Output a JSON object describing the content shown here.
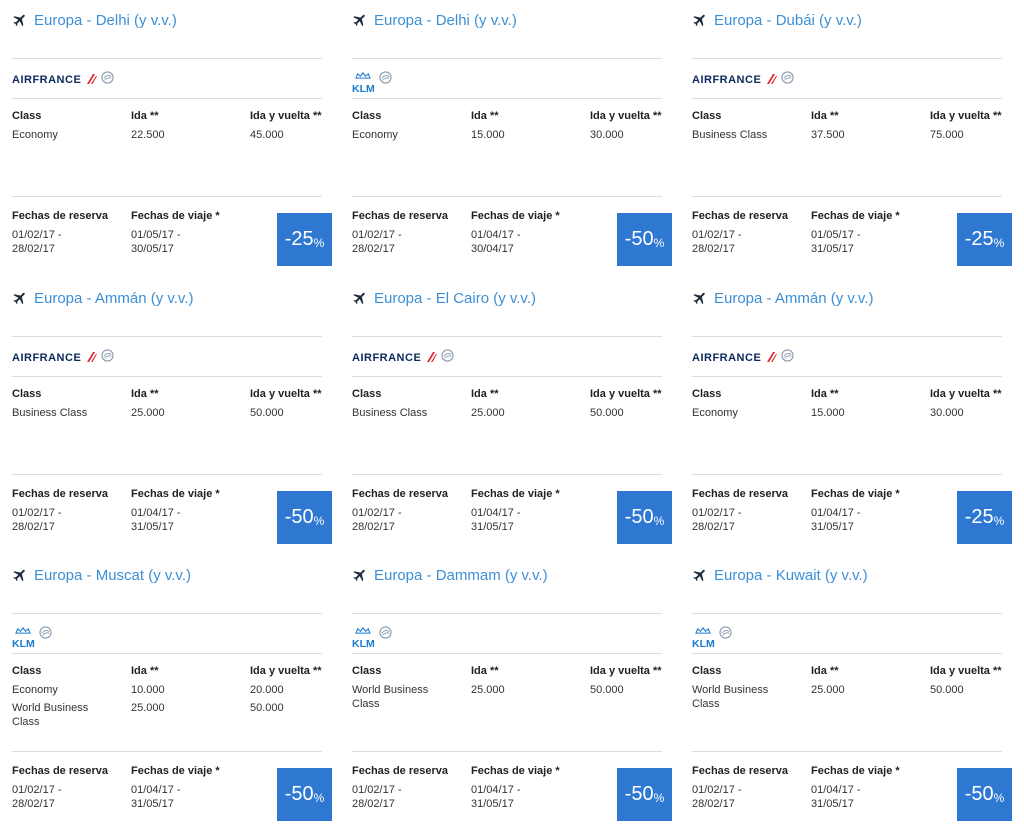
{
  "labels": {
    "class": "Class",
    "ida": "Ida **",
    "ida_vuelta": "Ida y vuelta **",
    "fechas_reserva": "Fechas de reserva",
    "fechas_viaje": "Fechas de viaje *",
    "percent": "%"
  },
  "colors": {
    "title": "#3d8fd6",
    "discount_bg": "#2e78d2",
    "airfrance_navy": "#0b2a5b",
    "airfrance_red": "#e1222a",
    "klm_blue": "#1a7bd1"
  },
  "cards": [
    {
      "title": "Europa - Delhi (y v.v.)",
      "airline": "AIRFRANCE",
      "rows": [
        {
          "class": "Economy",
          "ida": "22.500",
          "ida_vuelta": "45.000"
        }
      ],
      "reserva": [
        "01/02/17 -",
        "28/02/17"
      ],
      "viaje": [
        "01/05/17 -",
        "30/05/17"
      ],
      "discount": "-25"
    },
    {
      "title": "Europa - Delhi (y v.v.)",
      "airline": "KLM",
      "rows": [
        {
          "class": "Economy",
          "ida": "15.000",
          "ida_vuelta": "30.000"
        }
      ],
      "reserva": [
        "01/02/17 -",
        "28/02/17"
      ],
      "viaje": [
        "01/04/17 -",
        "30/04/17"
      ],
      "discount": "-50"
    },
    {
      "title": "Europa - Dubái (y v.v.)",
      "airline": "AIRFRANCE",
      "rows": [
        {
          "class": "Business Class",
          "ida": "37.500",
          "ida_vuelta": "75.000"
        }
      ],
      "reserva": [
        "01/02/17 -",
        "28/02/17"
      ],
      "viaje": [
        "01/05/17 -",
        "31/05/17"
      ],
      "discount": "-25"
    },
    {
      "title": "Europa - Ammán (y v.v.)",
      "airline": "AIRFRANCE",
      "rows": [
        {
          "class": "Business Class",
          "ida": "25.000",
          "ida_vuelta": "50.000"
        }
      ],
      "reserva": [
        "01/02/17 -",
        "28/02/17"
      ],
      "viaje": [
        "01/04/17 -",
        "31/05/17"
      ],
      "discount": "-50"
    },
    {
      "title": "Europa - El Cairo (y v.v.)",
      "airline": "AIRFRANCE",
      "rows": [
        {
          "class": "Business Class",
          "ida": "25.000",
          "ida_vuelta": "50.000"
        }
      ],
      "reserva": [
        "01/02/17 -",
        "28/02/17"
      ],
      "viaje": [
        "01/04/17 -",
        "31/05/17"
      ],
      "discount": "-50"
    },
    {
      "title": "Europa - Ammán (y v.v.)",
      "airline": "AIRFRANCE",
      "rows": [
        {
          "class": "Economy",
          "ida": "15.000",
          "ida_vuelta": "30.000"
        }
      ],
      "reserva": [
        "01/02/17 -",
        "28/02/17"
      ],
      "viaje": [
        "01/04/17 -",
        "31/05/17"
      ],
      "discount": "-25"
    },
    {
      "title": "Europa - Muscat (y v.v.)",
      "airline": "KLM",
      "rows": [
        {
          "class": "Economy",
          "ida": "10.000",
          "ida_vuelta": "20.000"
        },
        {
          "class": "World Business Class",
          "ida": "25.000",
          "ida_vuelta": "50.000"
        }
      ],
      "reserva": [
        "01/02/17 -",
        "28/02/17"
      ],
      "viaje": [
        "01/04/17 -",
        "31/05/17"
      ],
      "discount": "-50"
    },
    {
      "title": "Europa - Dammam (y v.v.)",
      "airline": "KLM",
      "rows": [
        {
          "class": "World Business Class",
          "ida": "25.000",
          "ida_vuelta": "50.000"
        }
      ],
      "reserva": [
        "01/02/17 -",
        "28/02/17"
      ],
      "viaje": [
        "01/04/17 -",
        "31/05/17"
      ],
      "discount": "-50"
    },
    {
      "title": "Europa - Kuwait (y v.v.)",
      "airline": "KLM",
      "rows": [
        {
          "class": "World Business Class",
          "ida": "25.000",
          "ida_vuelta": "50.000"
        }
      ],
      "reserva": [
        "01/02/17 -",
        "28/02/17"
      ],
      "viaje": [
        "01/04/17 -",
        "31/05/17"
      ],
      "discount": "-50"
    }
  ]
}
